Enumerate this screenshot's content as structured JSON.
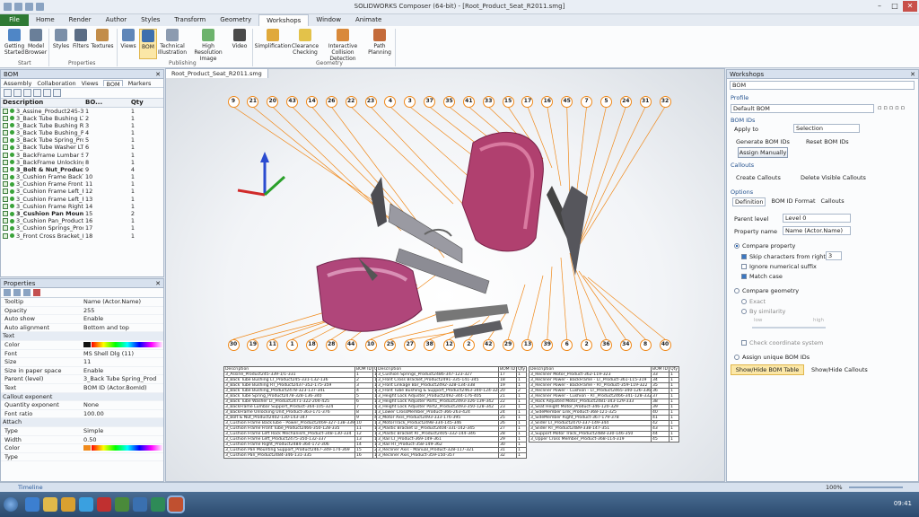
{
  "app": {
    "title": "SOLIDWORKS Composer (64-bit) - [Root_Product_Seat_R2011.smg]"
  },
  "menu": {
    "file": "File",
    "tabs": [
      "Home",
      "Render",
      "Author",
      "Styles",
      "Transform",
      "Geometry",
      "Workshops",
      "Window",
      "Animate"
    ]
  },
  "ribbon": {
    "buttons": [
      {
        "label": "Getting Started"
      },
      {
        "label": "Model Browser"
      },
      {
        "label": "Styles"
      },
      {
        "label": "Filters"
      },
      {
        "label": "Textures"
      },
      {
        "label": "Views"
      },
      {
        "label": "BOM"
      },
      {
        "label": "Technical Illustration"
      },
      {
        "label": "High Resolution Image"
      },
      {
        "label": "Video"
      },
      {
        "label": "Simplification"
      },
      {
        "label": "Clearance Checking"
      },
      {
        "label": "Interactive Collision Detection"
      },
      {
        "label": "Path Planning"
      }
    ],
    "groups": [
      "Start",
      "Properties",
      "Publishing",
      "Geometry"
    ]
  },
  "bom_panel": {
    "title": "BOM",
    "tabs": [
      "Assembly",
      "Collaboration",
      "Views",
      "BOM",
      "Markers"
    ],
    "columns": [
      "Description",
      "BO...",
      "Qty"
    ],
    "rows": [
      {
        "d": "3_Assine_Product245-339-1",
        "b": "1",
        "q": "1"
      },
      {
        "d": "3_Back Tube Bushing LT_P",
        "b": "2",
        "q": "1"
      },
      {
        "d": "3_Back Tube Bushing RT_F",
        "b": "3",
        "q": "1"
      },
      {
        "d": "3_Back Tube Bushing_Prod",
        "b": "4",
        "q": "1"
      },
      {
        "d": "3_Back Tube Spring_Produ",
        "b": "5",
        "q": "1"
      },
      {
        "d": "3_Back Tube Washer LT_Pr",
        "b": "6",
        "q": "1"
      },
      {
        "d": "3_BackFrame Lumbar Supp",
        "b": "7",
        "q": "1"
      },
      {
        "d": "3_BackFrame Unlocking Ur",
        "b": "8",
        "q": "1"
      },
      {
        "d": "3_Bolt & Nut_Product24(",
        "b": "9",
        "q": "4",
        "bold": true
      },
      {
        "d": "3_Cushion Frame BackTub",
        "b": "10",
        "q": "1"
      },
      {
        "d": "3_Cushion Frame Front Tu",
        "b": "11",
        "q": "1"
      },
      {
        "d": "3_Cushion Frame Left_Roc",
        "b": "12",
        "q": "1"
      },
      {
        "d": "3_Cushion Frame Left_Pro",
        "b": "13",
        "q": "1"
      },
      {
        "d": "3_Cushion Frame Right_Pr",
        "b": "14",
        "q": "1"
      },
      {
        "d": "3_Cushion Pan Mounting",
        "b": "15",
        "q": "2",
        "bold": true
      },
      {
        "d": "3_Cushion Pan_Product24(",
        "b": "16",
        "q": "1"
      },
      {
        "d": "3_Cushion Springs_Produc",
        "b": "17",
        "q": "1"
      },
      {
        "d": "3_Front Cross Bracket_Pro",
        "b": "18",
        "q": "1"
      }
    ]
  },
  "properties": {
    "title": "Properties",
    "rows": [
      {
        "k": "Tooltip",
        "v": "Name (Actor.Name)"
      },
      {
        "k": "Opacity",
        "v": "255"
      },
      {
        "k": "Auto show",
        "v": "Enable"
      },
      {
        "k": "Auto alignment",
        "v": "Bottom and top"
      },
      {
        "k": "Text",
        "v": "",
        "sec": true
      },
      {
        "k": "Color",
        "v": ""
      },
      {
        "k": "Font",
        "v": "MS Shell Dlg (11)"
      },
      {
        "k": "Size",
        "v": "11"
      },
      {
        "k": "Size in paper space",
        "v": "Enable"
      },
      {
        "k": "Parent (level)",
        "v": "3_Back Tube Spring_Prod"
      },
      {
        "k": "Text",
        "v": "BOM ID (Actor.BomId)"
      },
      {
        "k": "Callout exponent",
        "v": "",
        "sec": true
      },
      {
        "k": "Quantity exponent",
        "v": "None"
      },
      {
        "k": "Font ratio",
        "v": "100.00"
      },
      {
        "k": "Attach",
        "v": "",
        "sec": true
      },
      {
        "k": "Type",
        "v": "Simple"
      },
      {
        "k": "Width",
        "v": "0.50"
      },
      {
        "k": "Color",
        "v": ""
      },
      {
        "k": "Type",
        "v": ""
      }
    ]
  },
  "viewport": {
    "tab": "Root_Product_Seat_R2011.smg",
    "top_callouts": [
      "9",
      "21",
      "20",
      "43",
      "14",
      "26",
      "22",
      "23",
      "4",
      "3",
      "37",
      "35",
      "41",
      "33",
      "15",
      "17",
      "16",
      "45",
      "7",
      "5",
      "24",
      "31",
      "32"
    ],
    "bottom_callouts": [
      "30",
      "19",
      "11",
      "1",
      "18",
      "28",
      "44",
      "10",
      "25",
      "27",
      "38",
      "12",
      "2",
      "42",
      "29",
      "13",
      "39",
      "6",
      "2",
      "36",
      "34",
      "8",
      "40"
    ]
  },
  "bom_table": {
    "columns": [
      "Description",
      "BOM ID",
      "Qty"
    ],
    "t1": [
      [
        "3_Assine_Product245-339-1/1-331",
        "1",
        "1"
      ],
      [
        "3_Back Tube Bushing LT_Product245-331-132-136",
        "2",
        "1"
      ],
      [
        "3_Back Tube Bushing RT_Product2437-352-175-359",
        "3",
        "1"
      ],
      [
        "3_Back Tube Bushing_Product2478-323-137-341",
        "4",
        "1"
      ],
      [
        "3_Back Tube Spring_Product2478-328-136-340",
        "5",
        "1"
      ],
      [
        "3_Back Tube Washer LT_Product2471-322-204-425",
        "6",
        "1"
      ],
      [
        "3_BackFrame Lumbar Support_Product-364-105-324",
        "7",
        "1"
      ],
      [
        "3_BackFrame Unlocking Unit_Product-363-171-376",
        "8",
        "1"
      ],
      [
        "3_Bolt & Nut_Product2402-130-143-347",
        "9",
        "4"
      ],
      [
        "3_Cushion Frame BackTube - Power_Product2469-327-138-339",
        "10",
        "1"
      ],
      [
        "3_Cushion Frame Front Tube_Product2466-350-128-335",
        "11",
        "1"
      ],
      [
        "3_Cushion Frame Left Rock Mechanism_Product-348-130-334",
        "12",
        "1"
      ],
      [
        "3_Cushion Frame Left_Product2475-350-132-337",
        "13",
        "1"
      ],
      [
        "3_Cushion Frame Right_Product2484-364-172-306",
        "14",
        "1"
      ],
      [
        "3_Cushion Pan Mounting Support_Product2467-349-174-369",
        "15",
        "2"
      ],
      [
        "3_Cushion Pan_Product2484-346-131-335",
        "16",
        "1"
      ]
    ],
    "t2": [
      [
        "3_Cushion Springs_Product2486-347-123-327",
        "17",
        "1"
      ],
      [
        "3_Front Cross Bracket_Product2491-335-141-345",
        "18",
        "1"
      ],
      [
        "3_Front Linkage Bar_Product2492-328-134-338",
        "19",
        "1"
      ],
      [
        "3_Front Tube Bushing & Support_Product2463-340-124-328",
        "20",
        "2"
      ],
      [
        "3_Height Lock Adjuster_Product2492-344-176-405",
        "21",
        "1"
      ],
      [
        "3_Height Lock Adjuster Part1_Product2493-326-139-342",
        "22",
        "1"
      ],
      [
        "3_Height Lock Adjuster Part2_Product2493-350-128-342",
        "23",
        "1"
      ],
      [
        "3_Lower CrossMember_Product-366-263-424",
        "24",
        "1"
      ],
      [
        "3_Motor Axis_Product2493-333-176-395",
        "25",
        "1"
      ],
      [
        "3_MotorTrack_Product2498-334-145-346",
        "26",
        "1"
      ],
      [
        "3_Plastic Bracket LT_Product2404-331-142-345",
        "27",
        "1"
      ],
      [
        "3_Plastic Bracket RT_Product2405-332-144-346",
        "28",
        "1"
      ],
      [
        "3_Rail LT_Product-369-149-361",
        "29",
        "1"
      ],
      [
        "3_Rail RT_Product-358-149-362",
        "30",
        "1"
      ],
      [
        "3_Recliner Axis - Manual_Product-328-117-321",
        "31",
        "1"
      ],
      [
        "3_Recliner Axis_Product-359-150-357",
        "32",
        "1"
      ]
    ],
    "t3": [
      [
        "3_Recliner Motor_Product-362-119-323",
        "33",
        "1"
      ],
      [
        "3_Recliner Power - BackFrame - LT_Product-361-115-319",
        "34",
        "1"
      ],
      [
        "3_Recliner Power - BackFrame - RT_Product-359-119-322",
        "35",
        "1"
      ],
      [
        "3_Recliner Power - Cushion - LT_Product2465-340-126-336",
        "36",
        "1"
      ],
      [
        "3_Recliner Power - Cushion - RT_Product2466-341-128-332",
        "37",
        "1"
      ],
      [
        "3_Rock Adjusted Motor_Product2481-343-129-333",
        "38",
        "1"
      ],
      [
        "3_Seat Height Motor_Product-346-120-329",
        "39",
        "1"
      ],
      [
        "3_SideMember Link_Product-368-121-325",
        "40",
        "1"
      ],
      [
        "3_SideMember Right_Product-367-179-378",
        "41",
        "1"
      ],
      [
        "3_Slider LT_Product2470-337-149-344",
        "42",
        "1"
      ],
      [
        "3_Slider RT_Product2489-338-147-351",
        "43",
        "1"
      ],
      [
        "3_Support Motor Track_Product2488-330-146-350",
        "44",
        "1"
      ],
      [
        "3_Upper Cross Member_Product-368-114-319",
        "45",
        "1"
      ]
    ]
  },
  "workshops": {
    "title": "Workshops",
    "selected": "BOM",
    "profile_label": "Profile",
    "profile": "Default BOM",
    "bom_ids_label": "BOM IDs",
    "apply_to_label": "Apply to",
    "apply_to": "Selection",
    "generate": "Generate BOM IDs",
    "reset": "Reset BOM IDs",
    "assign": "Assign Manually",
    "callouts_label": "Callouts",
    "create_callouts": "Create Callouts",
    "delete_callouts": "Delete Visible Callouts",
    "options_label": "Options",
    "option_tabs": [
      "Definition",
      "BOM ID Format",
      "Callouts"
    ],
    "parent_level_label": "Parent level",
    "parent_level": "Level 0",
    "property_name_label": "Property name",
    "property_name": "Name (Actor.Name)",
    "compare_property": "Compare property",
    "skip_chars": "Skip characters from right",
    "skip_value": "3",
    "ignore_suffix": "Ignore numerical suffix",
    "match_case": "Match case",
    "compare_geometry": "Compare geometry",
    "exact": "Exact",
    "by_similarity": "By similarity",
    "low": "low",
    "high": "high",
    "check_coord": "Check coordinate system",
    "assign_unique": "Assign unique BOM IDs",
    "show_hide_table": "Show/Hide BOM Table",
    "show_hide_callouts": "Show/Hide Callouts"
  },
  "status": {
    "timeline": "Timeline",
    "zoom": "100%"
  },
  "taskbar": {
    "clock": "09:41"
  },
  "colors": {
    "accent": "#f08a1c",
    "file_tab": "#2f7a34",
    "seat": "#b0406f"
  }
}
